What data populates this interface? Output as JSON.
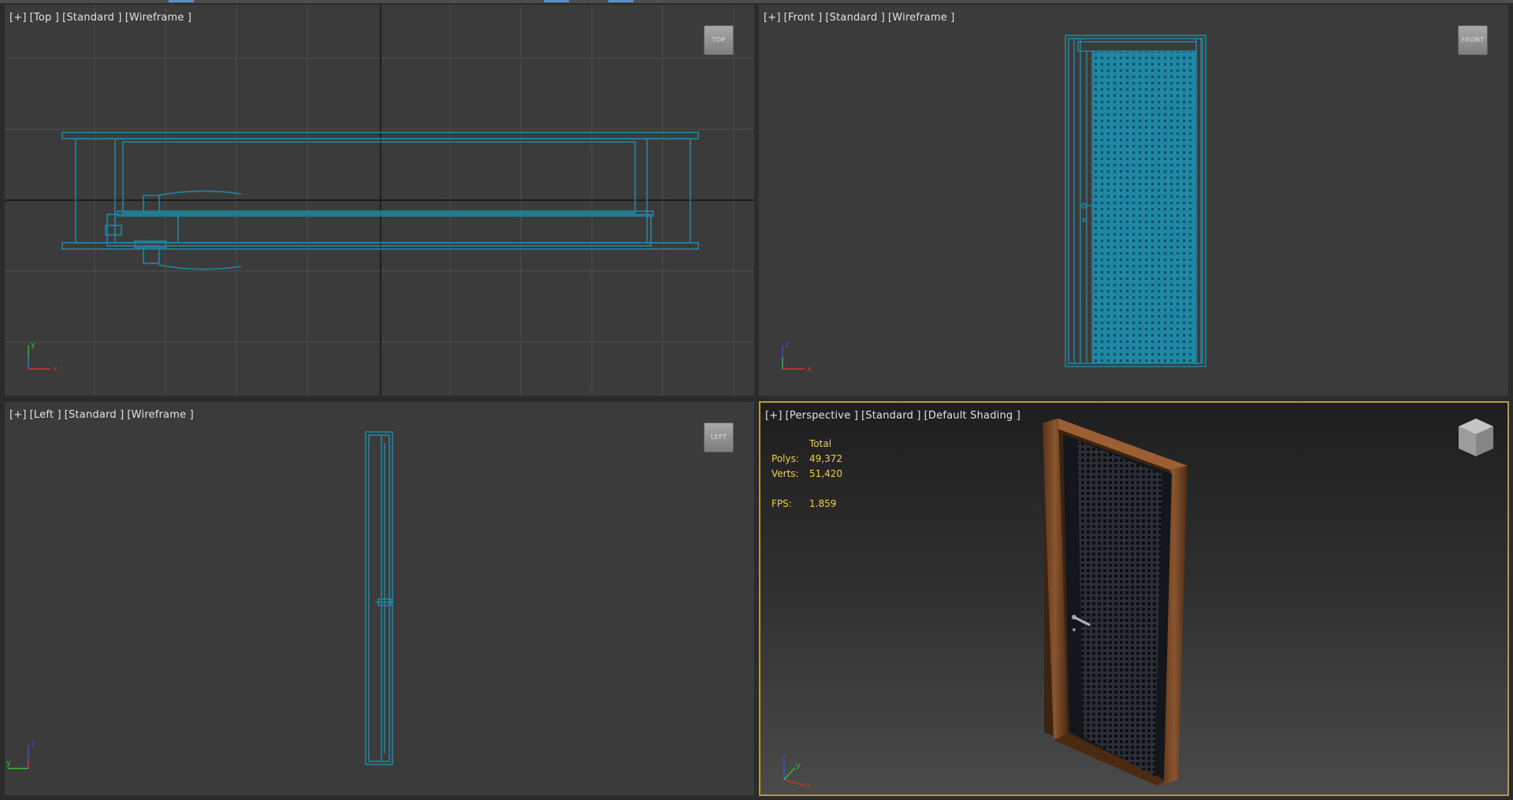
{
  "viewports": {
    "top": {
      "labels": [
        "[+]",
        "[Top ]",
        "[Standard ]",
        "[Wireframe ]"
      ],
      "viewcube": "TOP",
      "axis_labels": {
        "a": "y",
        "b": "x"
      }
    },
    "front": {
      "labels": [
        "[+]",
        "[Front ]",
        "[Standard ]",
        "[Wireframe ]"
      ],
      "viewcube": "FRONT",
      "axis_labels": {
        "a": "z",
        "b": "x"
      }
    },
    "left": {
      "labels": [
        "[+]",
        "[Left ]",
        "[Standard ]",
        "[Wireframe ]"
      ],
      "viewcube": "LEFT",
      "axis_labels": {
        "a": "z",
        "b": "y"
      }
    },
    "perspective": {
      "labels": [
        "[+]",
        "[Perspective ]",
        "[Standard ]",
        "[Default Shading ]"
      ],
      "stats": {
        "header": "Total",
        "polys_label": "Polys:",
        "polys": "49,372",
        "verts_label": "Verts:",
        "verts": "51,420",
        "fps_label": "FPS:",
        "fps": "1.859"
      },
      "axis_labels": {
        "a": "z",
        "b": "x",
        "c": "y"
      }
    }
  },
  "colors": {
    "wireframe": "#1f87a3",
    "grid": "#4d4d4d",
    "grid_axis": "#0a0a0a",
    "active_border": "#b39b3c",
    "stats_text": "#f0d24a"
  }
}
